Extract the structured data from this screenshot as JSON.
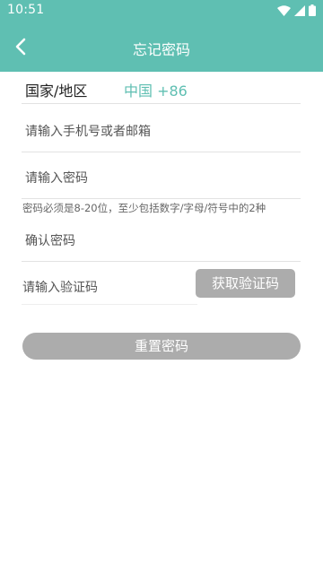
{
  "status": {
    "time": "10:51"
  },
  "appbar": {
    "title": "忘记密码"
  },
  "form": {
    "region_label": "国家/地区",
    "region_value": "中国 +86",
    "account_placeholder": "请输入手机号或者邮箱",
    "password_placeholder": "请输入密码",
    "password_hint": "密码必须是8-20位，至少包括数字/字母/符号中的2种",
    "confirm_placeholder": "确认密码",
    "code_placeholder": "请输入验证码",
    "get_code_label": "获取验证码",
    "reset_label": "重置密码"
  },
  "colors": {
    "accent": "#5fbfb2",
    "button_disabled": "#acacac"
  }
}
